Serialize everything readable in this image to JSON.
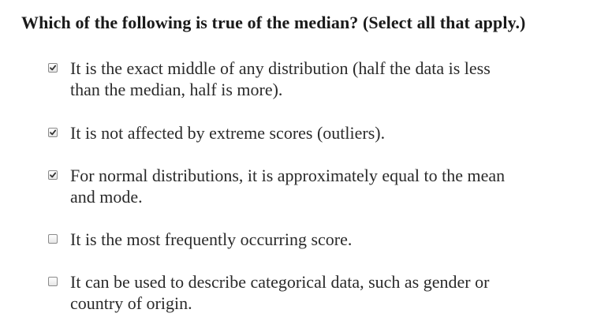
{
  "question": {
    "text": "Which of the following is true of the median? (Select all that apply.)"
  },
  "options": [
    {
      "text": "It is the exact middle of any distribution (half the data is less than the median, half is more).",
      "checked": true
    },
    {
      "text": "It is not affected by extreme scores (outliers).",
      "checked": true
    },
    {
      "text": "For normal distributions, it is approximately equal to the mean and mode.",
      "checked": true
    },
    {
      "text": "It is the most frequently occurring score.",
      "checked": false
    },
    {
      "text": "It can be used to describe categorical data, such as gender or country of origin.",
      "checked": false
    }
  ]
}
